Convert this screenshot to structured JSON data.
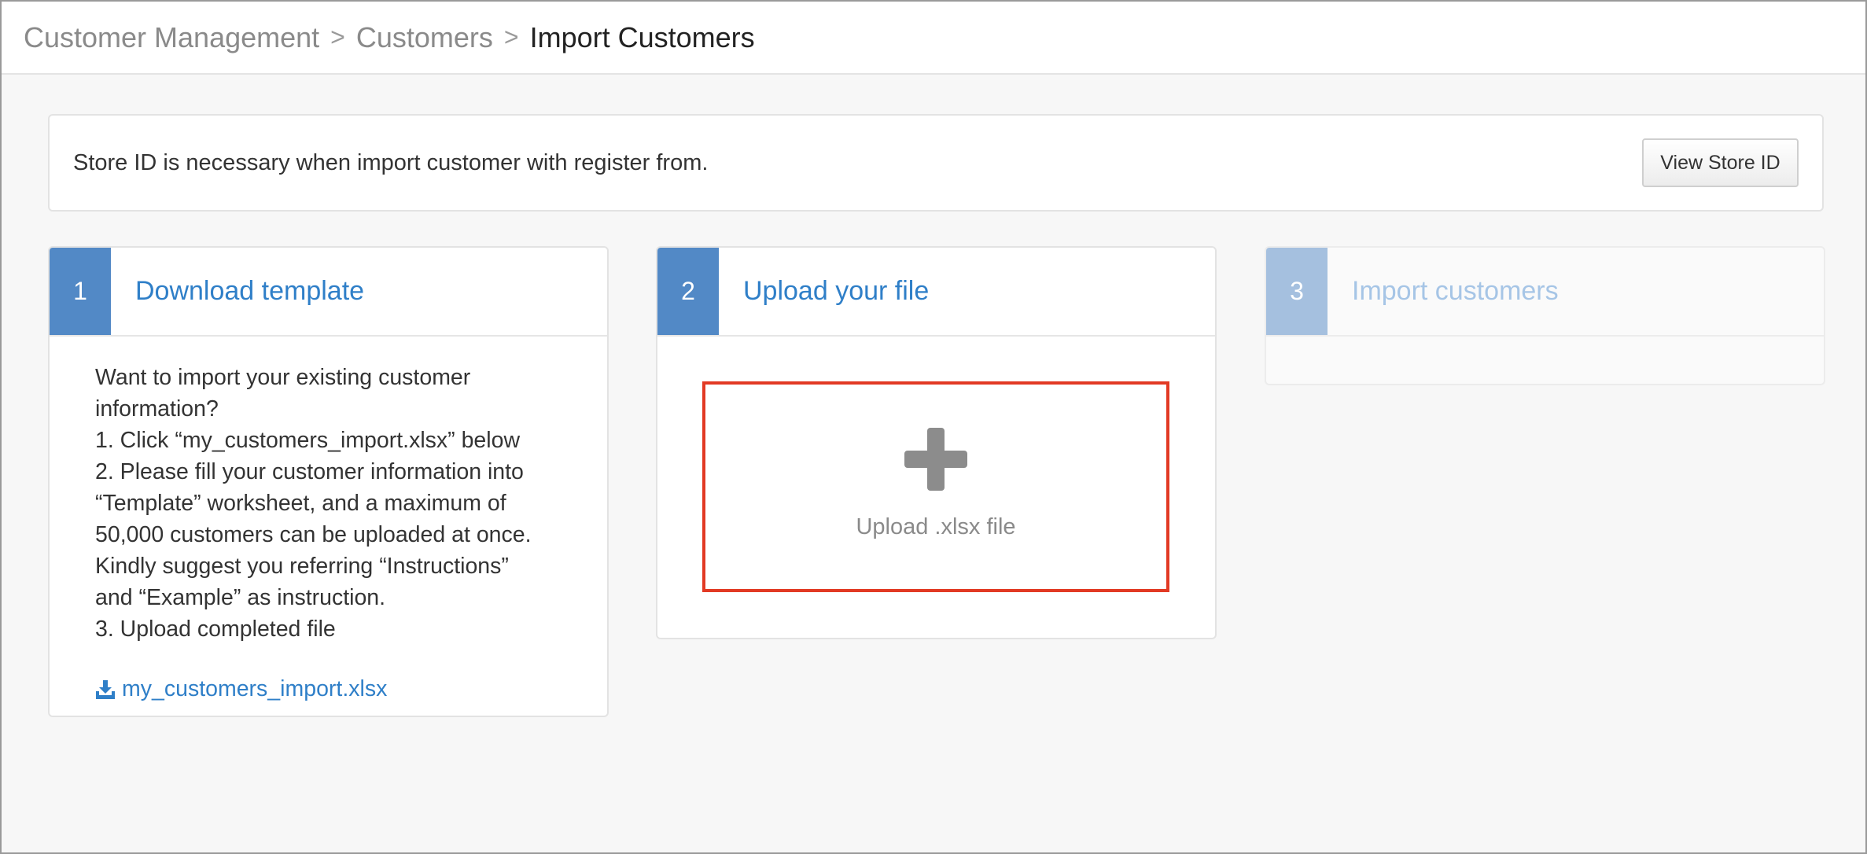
{
  "breadcrumb": {
    "items": [
      "Customer Management",
      "Customers",
      "Import Customers"
    ],
    "separator": ">"
  },
  "notice": {
    "text": "Store ID is necessary when import customer with register from.",
    "button_label": "View Store ID"
  },
  "steps": [
    {
      "number": "1",
      "title": "Download template",
      "instructions": [
        "Want to import your existing customer",
        "information?",
        "1. Click “my_customers_import.xlsx” below",
        "2. Please fill your customer information into",
        "“Template” worksheet, and a maximum of",
        "50,000 customers can be uploaded at once.",
        "Kindly suggest you referring “Instructions”",
        "and “Example” as instruction.",
        "3. Upload completed file"
      ],
      "download_link": "my_customers_import.xlsx"
    },
    {
      "number": "2",
      "title": "Upload your file",
      "upload_label": "Upload .xlsx file"
    },
    {
      "number": "3",
      "title": "Import customers",
      "state": "disabled"
    }
  ],
  "colors": {
    "step_active": "#5289c6",
    "step_disabled": "#a5c0df",
    "link": "#2f7fc8",
    "upload_highlight": "#e23a24"
  },
  "icons": {
    "download": "download-icon",
    "upload": "plus-icon"
  }
}
